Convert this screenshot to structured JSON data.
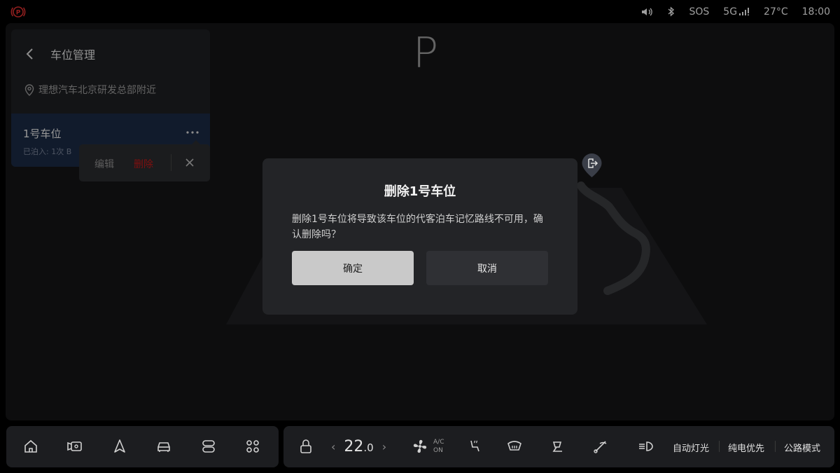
{
  "status_bar": {
    "park_brake_icon": "parking-brake-icon",
    "volume_icon": "volume-icon",
    "bluetooth_icon": "bluetooth-icon",
    "sos": "SOS",
    "network": "5G",
    "temperature": "27°C",
    "time": "18:00"
  },
  "main": {
    "gear": "P"
  },
  "side_panel": {
    "title": "车位管理",
    "location": "理想汽车北京研发总部附近",
    "slot": {
      "name": "1号车位",
      "meta": "已泊入: 1次   B"
    }
  },
  "context_menu": {
    "edit": "编辑",
    "delete": "删除"
  },
  "dialog": {
    "title": "删除1号车位",
    "message": "删除1号车位将导致该车位的代客泊车记忆路线不可用，确认删除吗？",
    "confirm": "确定",
    "cancel": "取消"
  },
  "dock": {
    "nav_icons": [
      "home-icon",
      "camera-icon",
      "navigation-icon",
      "car-icon",
      "toggle-icon",
      "apps-icon"
    ],
    "lock_icon": "lock-icon",
    "temp_left": "‹",
    "temp_value": "22",
    "temp_decimal": ".0",
    "temp_right": "›",
    "ac_top": "A/C",
    "ac_bottom": "ON",
    "modes": [
      "自动灯光",
      "纯电优先",
      "公路模式"
    ]
  },
  "colors": {
    "accent_selected": "#1b2a44",
    "danger": "#c21818",
    "park_brake": "#e03030",
    "confirm_button": "#c9c9c9"
  }
}
